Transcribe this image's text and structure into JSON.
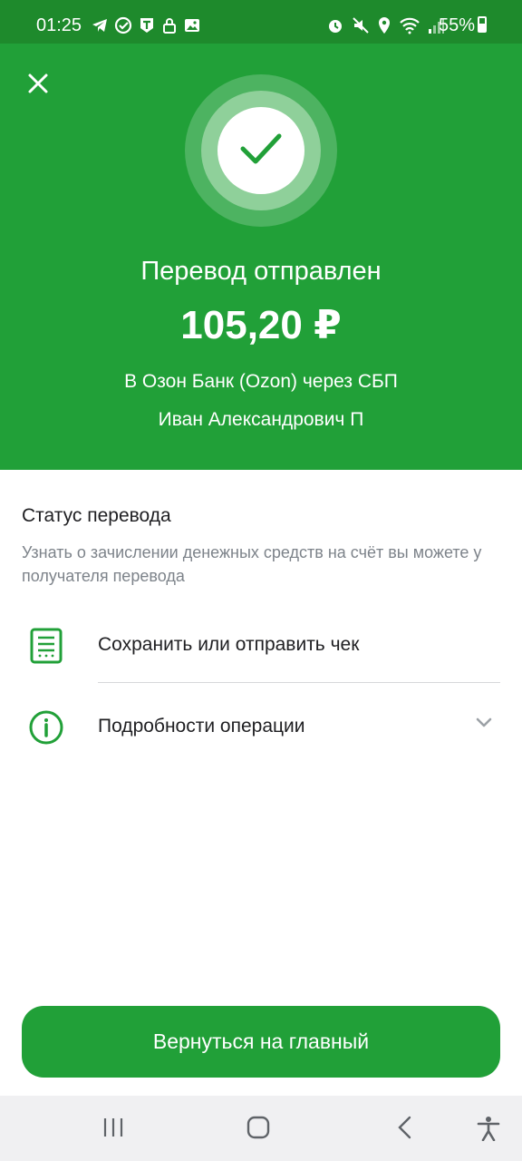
{
  "status_bar": {
    "time": "01:25",
    "battery": "55%",
    "icons": [
      "telegram-icon",
      "check-circle-icon",
      "t-icon",
      "lock-icon",
      "image-icon",
      "alarm-icon",
      "mute-icon",
      "location-icon",
      "wifi-icon",
      "signal-icon",
      "battery-icon"
    ]
  },
  "hero": {
    "title": "Перевод отправлен",
    "amount": "105,20 ₽",
    "bank": "В Озон Банк (Ozon) через СБП",
    "recipient": "Иван Александрович П"
  },
  "status": {
    "title": "Статус перевода",
    "description": "Узнать о зачислении денежных средств на счёт вы можете у получателя перевода"
  },
  "actions": {
    "receipt_label": "Сохранить или отправить чек",
    "details_label": "Подробности операции"
  },
  "footer": {
    "return_label": "Вернуться на главный"
  },
  "colors": {
    "brand_green": "#21a038",
    "status_green": "#1e8a2c"
  }
}
